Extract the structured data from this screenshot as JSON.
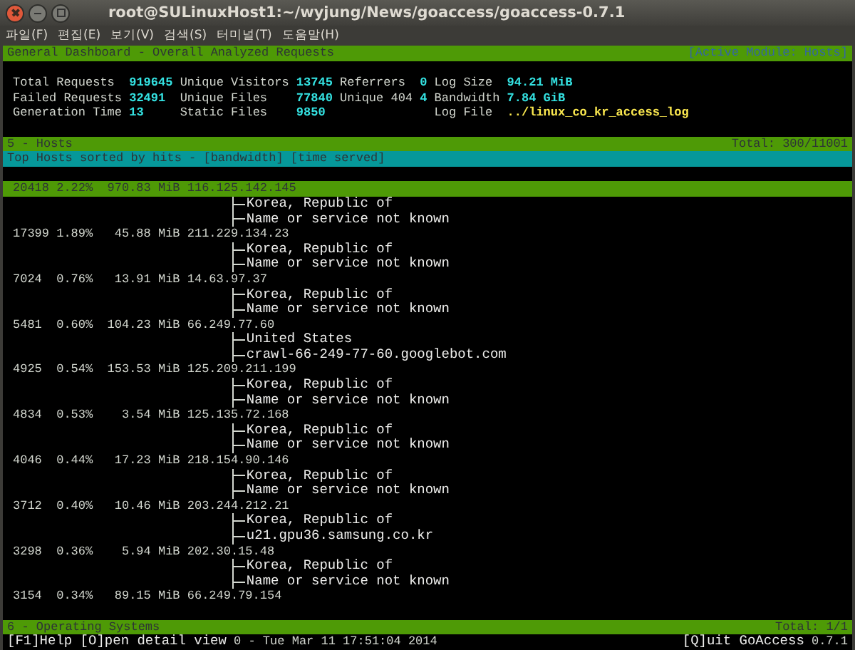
{
  "window": {
    "title": "root@SULinuxHost1:~/wyjung/News/goaccess/goaccess-0.7.1"
  },
  "menu": [
    "파일(F)",
    "편집(E)",
    "보기(V)",
    "검색(S)",
    "터미널(T)",
    "도움말(H)"
  ],
  "dashboard": {
    "title": "General Dashboard - Overall Analyzed Requests",
    "active_module": "[Active Module: Hosts]",
    "columns": [
      [
        {
          "label": "Total Requests",
          "value": "919645",
          "kind": "number"
        },
        {
          "label": "Failed Requests",
          "value": "32491",
          "kind": "number"
        },
        {
          "label": "Generation Time",
          "value": "13",
          "kind": "number"
        }
      ],
      [
        {
          "label": "Unique Visitors",
          "value": "13745",
          "kind": "number"
        },
        {
          "label": "Unique Files",
          "value": "77840",
          "kind": "number"
        },
        {
          "label": "Static Files",
          "value": "9850",
          "kind": "number"
        }
      ],
      [
        {
          "label": "Referrers",
          "value": "0",
          "kind": "number"
        },
        {
          "label": "Unique 404",
          "value": "4",
          "kind": "number"
        }
      ],
      [
        {
          "label": "Log Size",
          "value": "94.21",
          "unit": "MiB",
          "kind": "number"
        },
        {
          "label": "Bandwidth",
          "value": "7.84",
          "unit": "GiB",
          "kind": "number"
        },
        {
          "label": "Log File",
          "value": "../linux_co_kr_access_log",
          "kind": "path"
        }
      ]
    ]
  },
  "hosts": {
    "title": "5 - Hosts",
    "total": "Total: 300/11001",
    "subtitle": "Top Hosts sorted by hits - [bandwidth] [time served]",
    "rows": [
      {
        "hits": "20418",
        "percent": "2.22%",
        "bandwidth": "970.83",
        "unit": "MiB",
        "host": "116.125.142.145",
        "details": [
          "Korea, Republic of",
          "Name or service not known"
        ],
        "selected": true
      },
      {
        "hits": "17399",
        "percent": "1.89%",
        "bandwidth": "45.88",
        "unit": "MiB",
        "host": "211.229.134.23",
        "details": [
          "Korea, Republic of",
          "Name or service not known"
        ],
        "selected": false
      },
      {
        "hits": "7024",
        "percent": "0.76%",
        "bandwidth": "13.91",
        "unit": "MiB",
        "host": "14.63.97.37",
        "details": [
          "Korea, Republic of",
          "Name or service not known"
        ],
        "selected": false
      },
      {
        "hits": "5481",
        "percent": "0.60%",
        "bandwidth": "104.23",
        "unit": "MiB",
        "host": "66.249.77.60",
        "details": [
          "United States",
          "crawl-66-249-77-60.googlebot.com"
        ],
        "selected": false
      },
      {
        "hits": "4925",
        "percent": "0.54%",
        "bandwidth": "153.53",
        "unit": "MiB",
        "host": "125.209.211.199",
        "details": [
          "Korea, Republic of",
          "Name or service not known"
        ],
        "selected": false
      },
      {
        "hits": "4834",
        "percent": "0.53%",
        "bandwidth": "3.54",
        "unit": "MiB",
        "host": "125.135.72.168",
        "details": [
          "Korea, Republic of",
          "Name or service not known"
        ],
        "selected": false
      },
      {
        "hits": "4046",
        "percent": "0.44%",
        "bandwidth": "17.23",
        "unit": "MiB",
        "host": "218.154.90.146",
        "details": [
          "Korea, Republic of",
          "Name or service not known"
        ],
        "selected": false
      },
      {
        "hits": "3712",
        "percent": "0.40%",
        "bandwidth": "10.46",
        "unit": "MiB",
        "host": "203.244.212.21",
        "details": [
          "Korea, Republic of",
          "u21.gpu36.samsung.co.kr"
        ],
        "selected": false
      },
      {
        "hits": "3298",
        "percent": "0.36%",
        "bandwidth": "5.94",
        "unit": "MiB",
        "host": "202.30.15.48",
        "details": [
          "Korea, Republic of",
          "Name or service not known"
        ],
        "selected": false
      },
      {
        "hits": "3154",
        "percent": "0.34%",
        "bandwidth": "89.15",
        "unit": "MiB",
        "host": "66.249.79.154",
        "details": [],
        "selected": false
      }
    ]
  },
  "next_panel": {
    "title": "6 - Operating Systems",
    "total": "Total: 1/1"
  },
  "status_bar": {
    "help": "[F1]Help [O]pen detail view",
    "datetime": "0 - Tue Mar 11 17:51:04 2014",
    "quit": "[Q]uit GoAccess",
    "version": "0.7.1"
  }
}
